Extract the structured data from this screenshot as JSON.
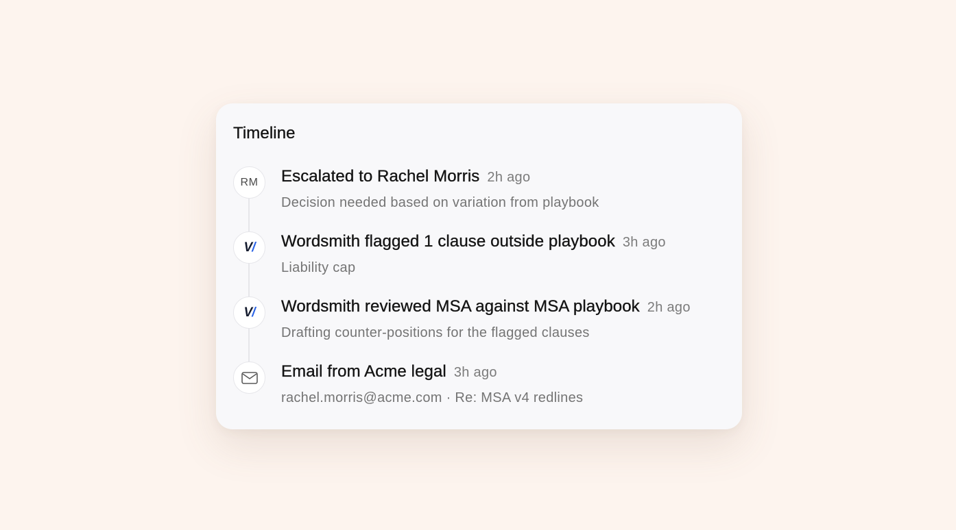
{
  "timeline": {
    "title": "Timeline",
    "items": [
      {
        "avatar_type": "initials",
        "avatar_text": "RM",
        "title": "Escalated to Rachel Morris",
        "time": "2h ago",
        "subtitle": "Decision needed based on variation from playbook"
      },
      {
        "avatar_type": "logo",
        "avatar_icon": "wordsmith-logo-icon",
        "logo_text_a": "V",
        "logo_text_b": "/",
        "title": "Wordsmith flagged 1 clause outside playbook",
        "time": "3h ago",
        "subtitle": "Liability cap"
      },
      {
        "avatar_type": "logo",
        "avatar_icon": "wordsmith-logo-icon",
        "logo_text_a": "V",
        "logo_text_b": "/",
        "title": "Wordsmith reviewed MSA against MSA playbook",
        "time": "2h ago",
        "subtitle": "Drafting counter-positions for the flagged clauses"
      },
      {
        "avatar_type": "icon",
        "avatar_icon": "mail-icon",
        "title": "Email from Acme legal",
        "time": "3h ago",
        "subtitle": "rachel.morris@acme.com · Re: MSA v4 redlines"
      }
    ]
  },
  "colors": {
    "page_background": "#fdf4ee",
    "card_background": "#f8f8fa",
    "brand_blue": "#2a63e6",
    "brand_dark": "#141b2e"
  }
}
